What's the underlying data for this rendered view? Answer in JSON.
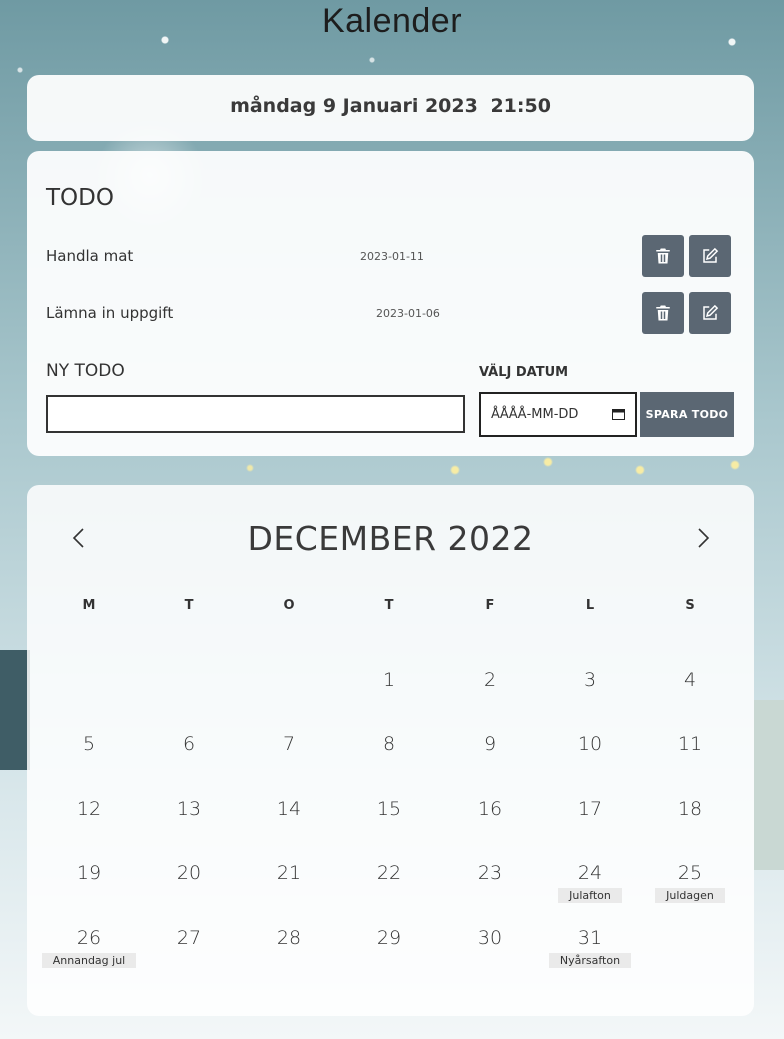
{
  "page": {
    "title": "Kalender"
  },
  "current": {
    "date": "måndag 9 Januari 2023",
    "time": "21:50"
  },
  "todo": {
    "heading": "TODO",
    "items": [
      {
        "title": "Handla mat",
        "date": "2023-01-11"
      },
      {
        "title": "Lämna in uppgift",
        "date": "2023-01-06"
      }
    ],
    "new_label": "NY TODO",
    "date_label": "VÄLJ DATUM",
    "date_placeholder": "ÅÅÅÅ-MM-DD",
    "save_label": "SPARA TODO"
  },
  "calendar": {
    "month_title": "DECEMBER 2022",
    "weekdays": [
      "M",
      "T",
      "O",
      "T",
      "F",
      "L",
      "S"
    ],
    "weeks": [
      [
        null,
        null,
        null,
        {
          "day": "1"
        },
        {
          "day": "2"
        },
        {
          "day": "3"
        },
        {
          "day": "4"
        }
      ],
      [
        {
          "day": "5"
        },
        {
          "day": "6"
        },
        {
          "day": "7"
        },
        {
          "day": "8"
        },
        {
          "day": "9"
        },
        {
          "day": "10"
        },
        {
          "day": "11"
        }
      ],
      [
        {
          "day": "12"
        },
        {
          "day": "13"
        },
        {
          "day": "14"
        },
        {
          "day": "15"
        },
        {
          "day": "16"
        },
        {
          "day": "17"
        },
        {
          "day": "18"
        }
      ],
      [
        {
          "day": "19"
        },
        {
          "day": "20"
        },
        {
          "day": "21"
        },
        {
          "day": "22"
        },
        {
          "day": "23"
        },
        {
          "day": "24",
          "holiday": "Julafton"
        },
        {
          "day": "25",
          "holiday": "Juldagen"
        }
      ],
      [
        {
          "day": "26",
          "holiday": "Annandag jul"
        },
        {
          "day": "27"
        },
        {
          "day": "28"
        },
        {
          "day": "29"
        },
        {
          "day": "30"
        },
        {
          "day": "31",
          "holiday": "Nyårsafton"
        },
        null
      ]
    ]
  },
  "icons": {
    "delete": "trash-icon",
    "edit": "edit-icon",
    "prev": "chevron-left-icon",
    "next": "chevron-right-icon",
    "date_picker": "calendar-icon"
  },
  "colors": {
    "button": "#5b6773",
    "card": "#ffffff",
    "text": "#333333"
  }
}
